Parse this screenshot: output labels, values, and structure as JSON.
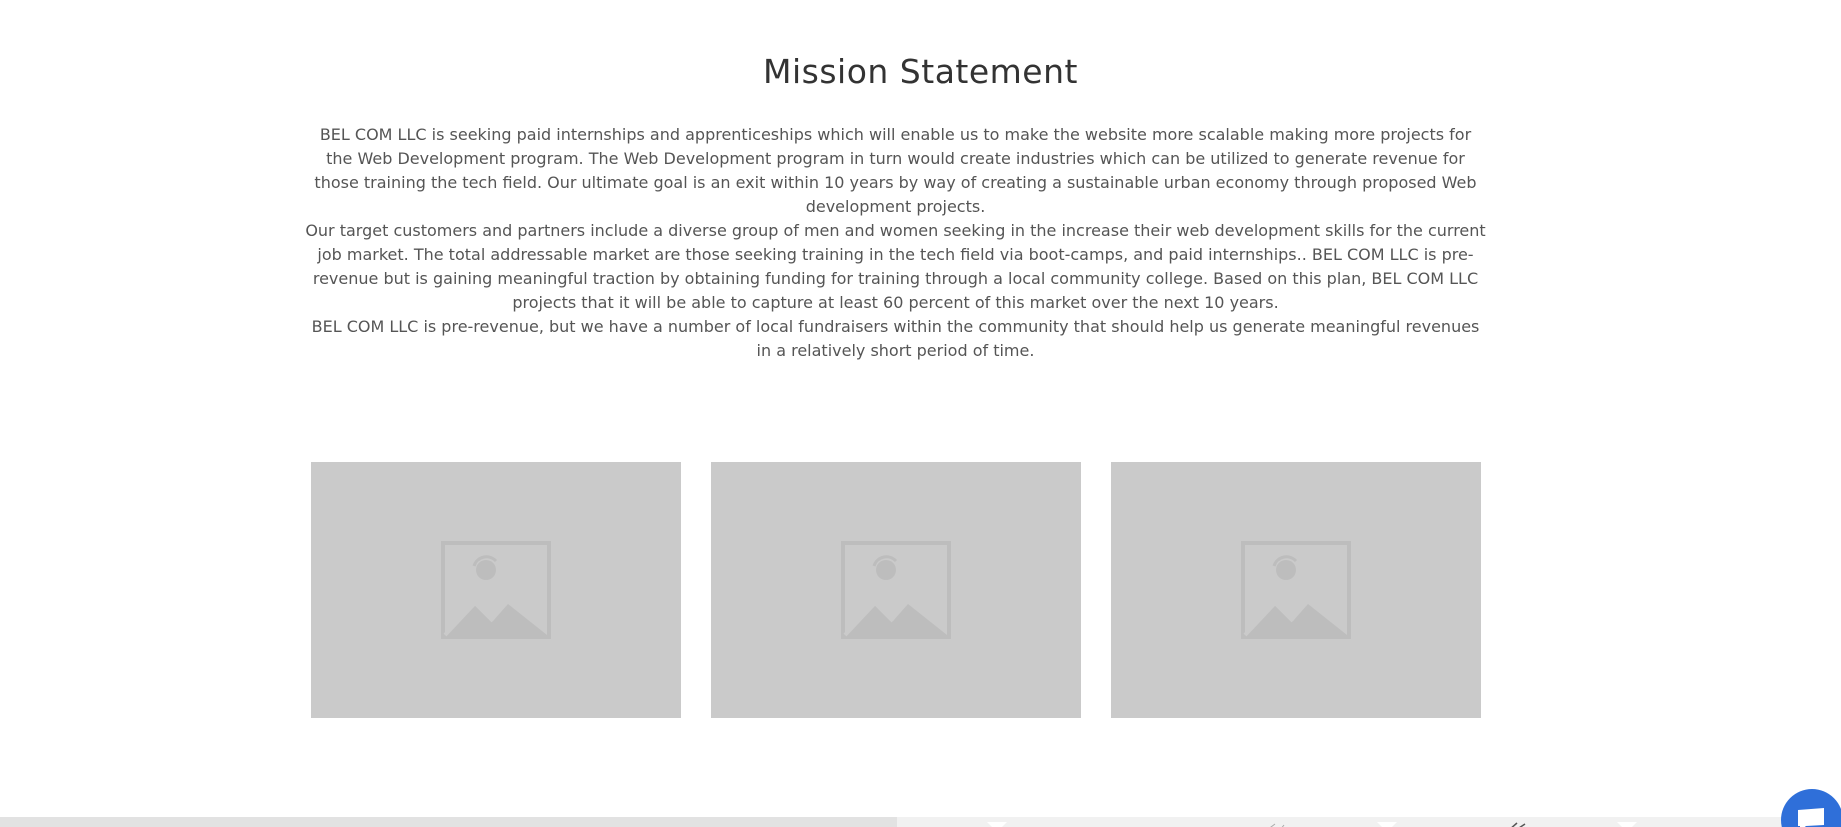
{
  "mission": {
    "title": "Mission Statement",
    "paragraphs": [
      "BEL COM LLC is seeking paid internships and apprenticeships which will enable us to make the website more scalable making more projects for the Web Development program. The Web Development program in turn would create industries which can be utilized to generate revenue for those training the tech field. Our ultimate goal is an exit within 10 years by way of creating a sustainable urban economy through proposed Web development projects.",
      "Our target customers and partners include a diverse group of men and women seeking in the increase their web development skills for the current job market. The total addressable market are those seeking training in the tech field via boot-camps, and paid internships.. BEL COM LLC is pre-revenue but is gaining meaningful traction by obtaining funding for training through a local community college. Based on this plan, BEL COM LLC projects that it will be able to capture at least 60 percent of this market over the next 10 years.",
      "BEL COM LLC is pre-revenue, but we have a number of local fundraisers within the community that should help us generate meaningful revenues in a relatively short period of time."
    ]
  },
  "gallery": {
    "items": [
      {
        "icon": "image-placeholder-icon"
      },
      {
        "icon": "image-placeholder-icon"
      },
      {
        "icon": "image-placeholder-icon"
      }
    ]
  },
  "chat": {
    "icon": "chat-bubble-icon",
    "color": "#2f6fd9"
  },
  "colors": {
    "placeholder_bg": "#cacaca",
    "placeholder_icon": "#bdbdbd",
    "text": "#555555",
    "title": "#333333"
  }
}
